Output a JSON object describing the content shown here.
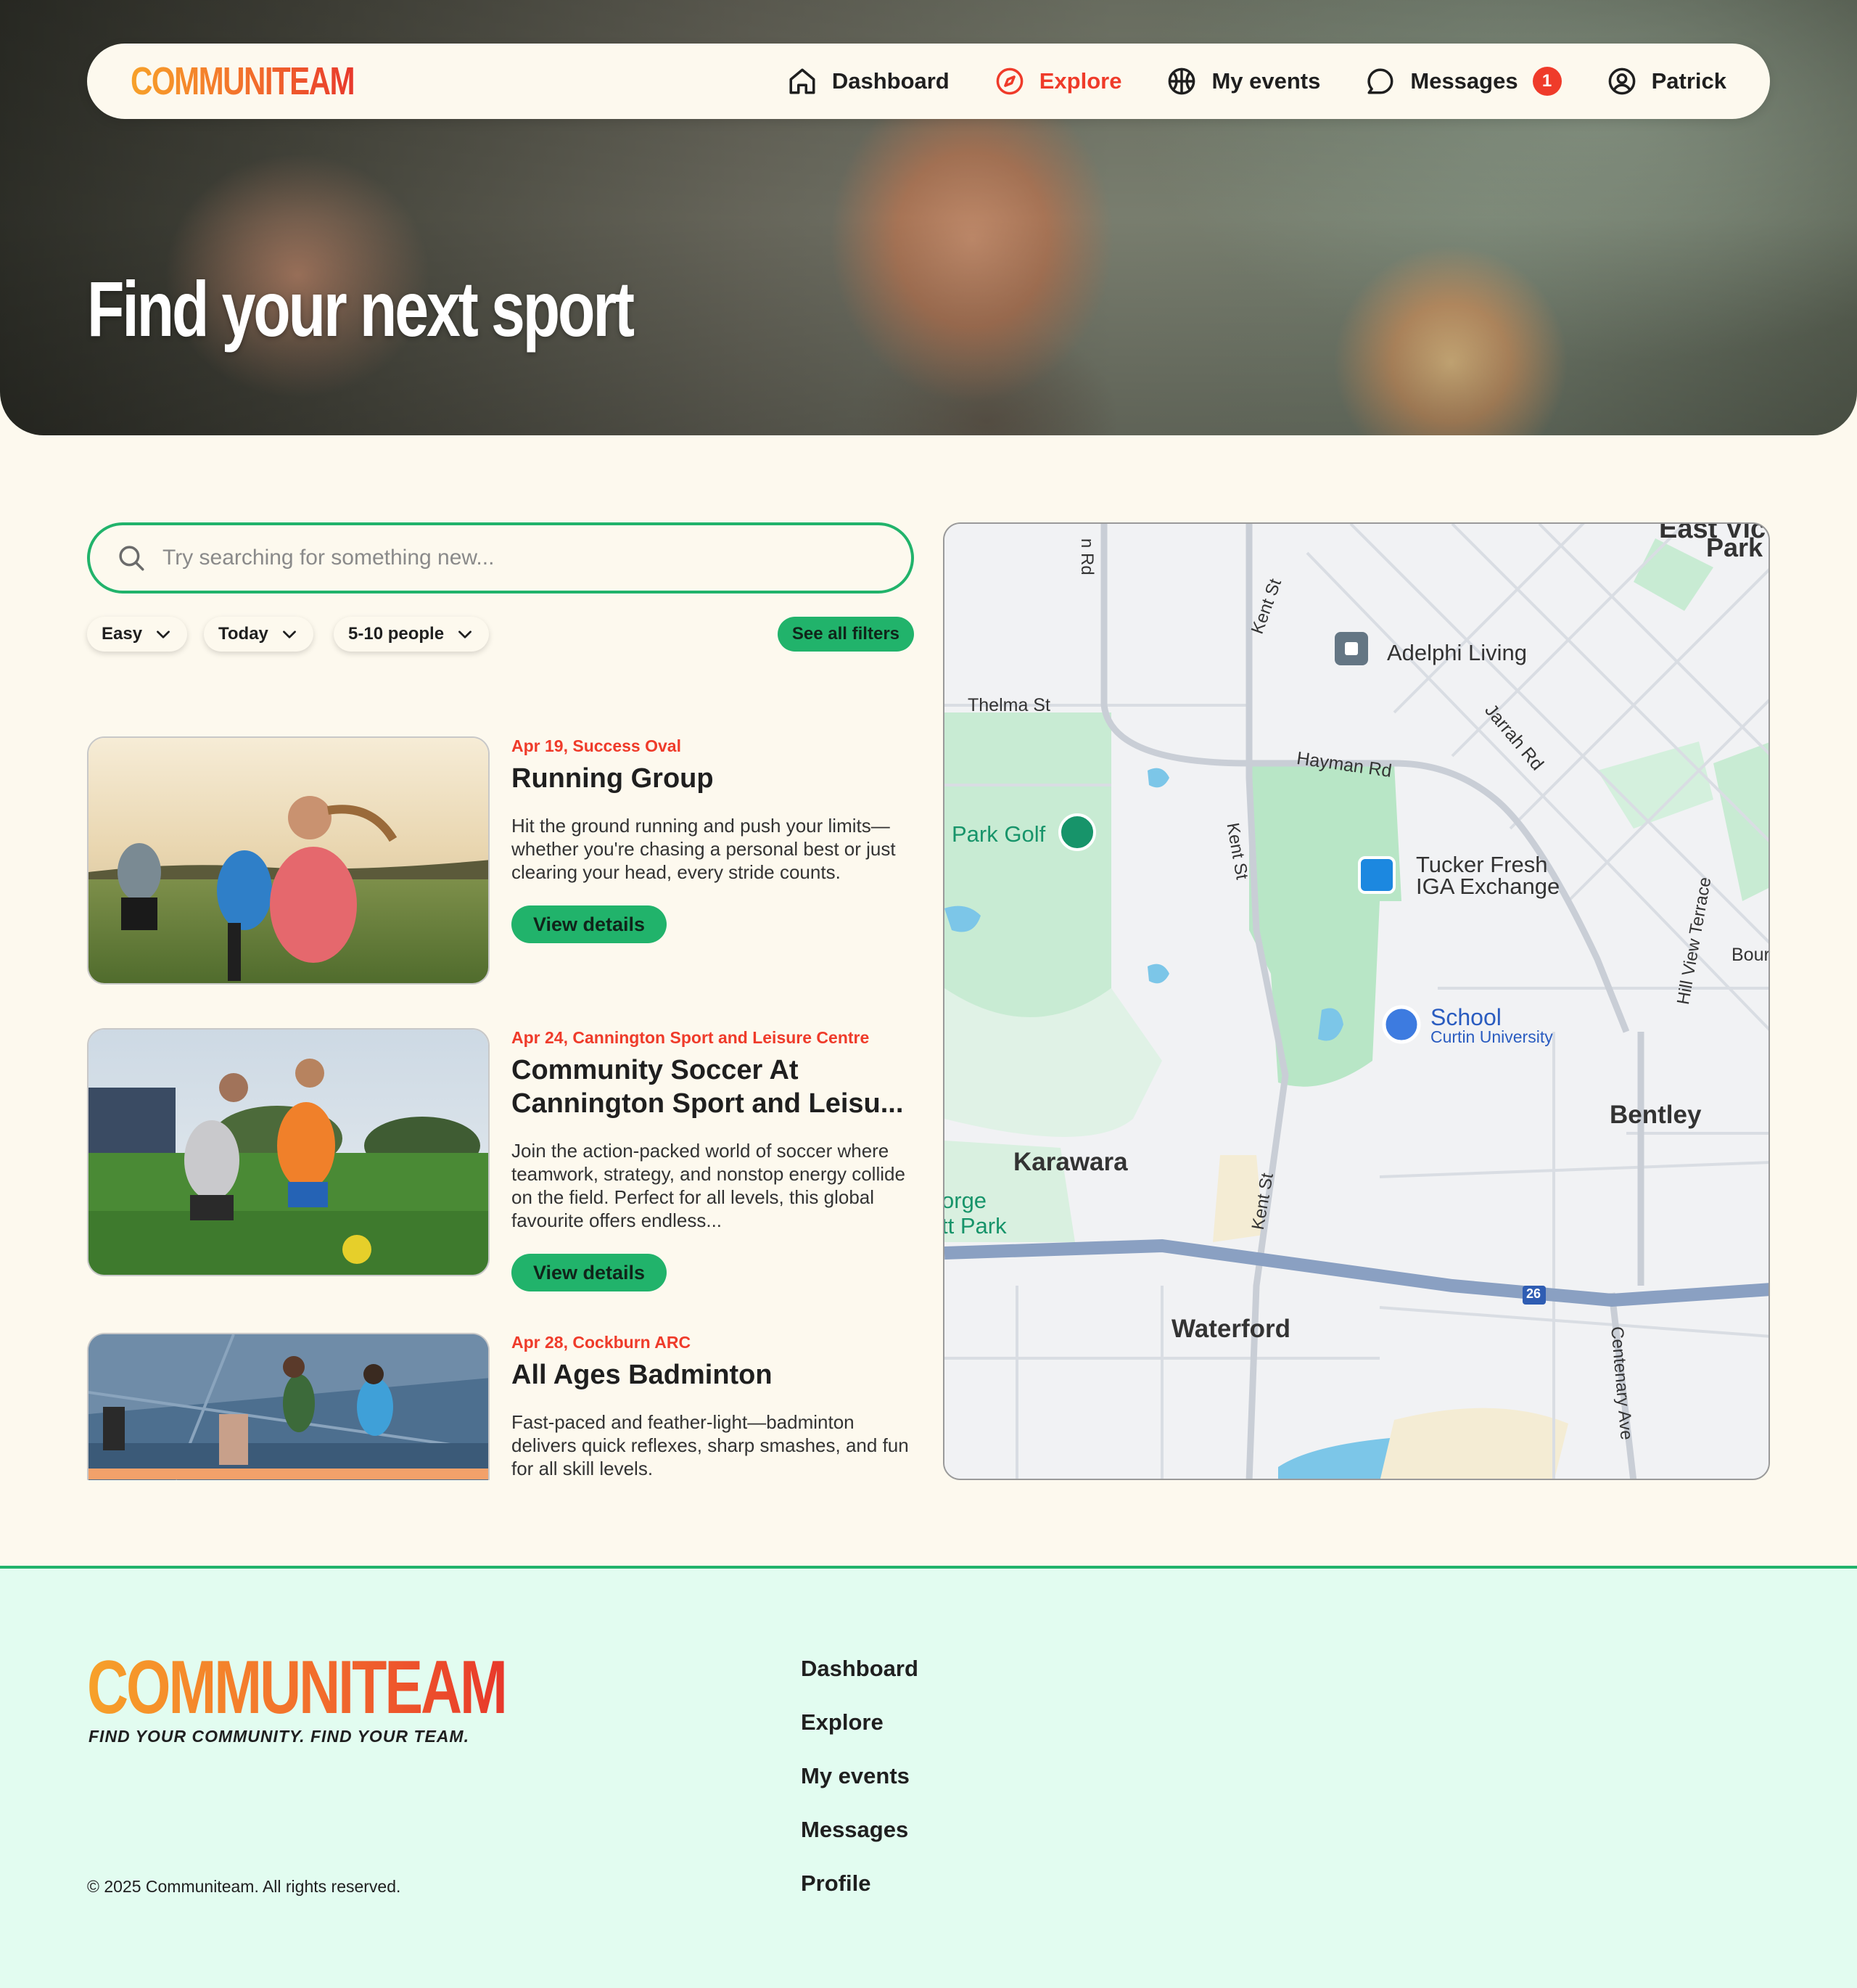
{
  "app": {
    "logo": "COMMUNITEAM",
    "tagline": "FIND YOUR COMMUNITY. FIND YOUR TEAM.",
    "copyright": "© 2025 Communiteam. All rights reserved."
  },
  "nav": {
    "items": [
      {
        "label": "Dashboard",
        "icon": "home-icon"
      },
      {
        "label": "Explore",
        "icon": "compass-icon",
        "active": true
      },
      {
        "label": "My events",
        "icon": "ball-icon"
      },
      {
        "label": "Messages",
        "icon": "chat-icon",
        "badge": "1"
      },
      {
        "label": "Patrick",
        "icon": "user-icon"
      }
    ]
  },
  "hero": {
    "title": "Find your next sport"
  },
  "search": {
    "placeholder": "Try searching for something new...",
    "value": ""
  },
  "filters": {
    "chips": [
      {
        "label": "Easy"
      },
      {
        "label": "Today"
      },
      {
        "label": "5-10 people"
      }
    ],
    "see_all": "See all filters"
  },
  "events": [
    {
      "date": "Apr 19, Success Oval",
      "title": "Running Group",
      "description": "Hit the ground running and push your limits—whether you're chasing a personal best or just clearing your head, every stride counts.",
      "button": "View details"
    },
    {
      "date": "Apr 24, Cannington Sport and Leisure Centre",
      "title": "Community Soccer At Cannington Sport and Leisu...",
      "description": "Join the action-packed world of soccer where teamwork, strategy, and nonstop energy collide on the field. Perfect for all levels, this global favourite offers endless...",
      "button": "View details"
    },
    {
      "date": "Apr 28, Cockburn ARC",
      "title": "All Ages Badminton",
      "description": "Fast-paced and feather-light—badminton delivers quick reflexes, sharp smashes, and fun for all skill levels.",
      "button": "View details"
    }
  ],
  "map": {
    "labels": {
      "east_vict": "East Vict",
      "park": "Park",
      "adelphi": "Adelphi Living",
      "thelma": "Thelma St",
      "hayman": "Hayman Rd",
      "jarrah": "Jarrah Rd",
      "kent_top": "Kent St",
      "kent_mid": "Kent St",
      "kent_low": "Kent St",
      "park_golf": "Park Golf",
      "tucker1": "Tucker Fresh",
      "tucker2": "IGA Exchange",
      "hill_view": "Hill View Terrace",
      "bour": "Bour",
      "school": "School",
      "curtin": "Curtin University",
      "bentley": "Bentley",
      "karawara": "Karawara",
      "orge": "orge",
      "tt_park": "tt Park",
      "waterford": "Waterford",
      "centenary": "Centenary Ave",
      "route": "26",
      "n_rd": "n Rd"
    }
  },
  "footer": {
    "links": [
      "Dashboard",
      "Explore",
      "My events",
      "Messages",
      "Profile"
    ]
  },
  "colors": {
    "accent_green": "#21b36b",
    "accent_red": "#ef3b2a",
    "logo_orange": "#f7a12a",
    "background": "#fdf9ee",
    "footer_bg": "#e2fcf0"
  }
}
